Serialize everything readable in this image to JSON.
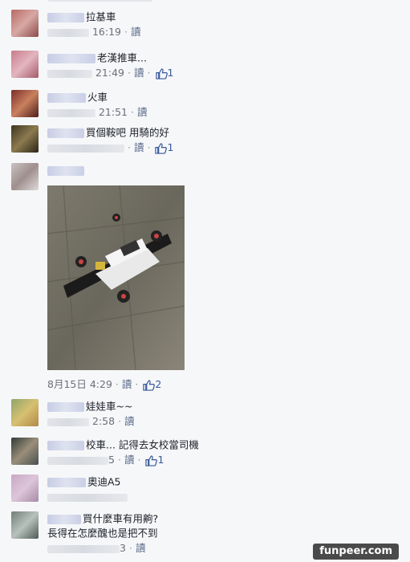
{
  "comments": [
    {
      "text": "拉基車",
      "meta_time": "16:19",
      "read": "讀",
      "likes": ""
    },
    {
      "text": "老漢推車...",
      "meta_time": "21:49",
      "read": "讀",
      "likes": "1"
    },
    {
      "text": "火車",
      "meta_time": "21:51",
      "read": "讀",
      "likes": ""
    },
    {
      "text": "買個鞍吧 用騎的好",
      "meta_time": "",
      "read": "讀",
      "likes": "1"
    },
    {
      "text": "",
      "meta_time": "8月15日 4:29",
      "read": "讀",
      "likes": "2"
    },
    {
      "text": "娃娃車~~",
      "meta_time": "2:58",
      "read": "讀",
      "likes": ""
    },
    {
      "text": "校車... 記得去女校當司機",
      "meta_time": "5",
      "read": "讀",
      "likes": "1"
    },
    {
      "text": "奧迪A5",
      "meta_time": "",
      "read": "",
      "likes": ""
    },
    {
      "text": "買什麼車有用齁?",
      "text2": "長得在怎麼醜也是把不到",
      "meta_time": "3",
      "read": "讀",
      "likes": ""
    }
  ],
  "watermark": "funpeer.com",
  "icons": {
    "like": "thumbs-up-icon"
  },
  "colors": {
    "link": "#365899",
    "meta": "#90949c",
    "bg": "#f6f7f9"
  }
}
